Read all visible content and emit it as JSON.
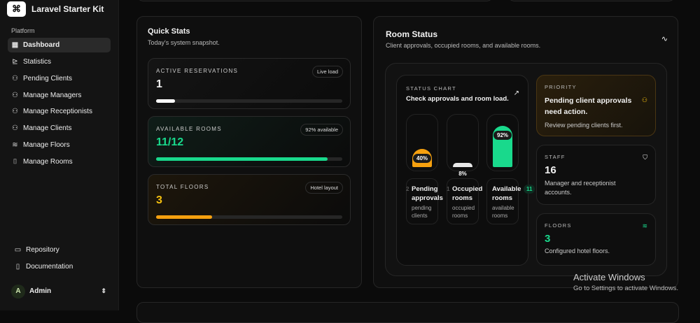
{
  "app": {
    "title": "Laravel Starter Kit",
    "logo_icon": "laravel-logo"
  },
  "sidebar": {
    "group": "Platform",
    "items": [
      {
        "label": "Dashboard",
        "icon": "grid-icon",
        "active": true
      },
      {
        "label": "Statistics",
        "icon": "chart-icon"
      },
      {
        "label": "Pending Clients",
        "icon": "users-icon"
      },
      {
        "label": "Manage Managers",
        "icon": "user-cog-icon"
      },
      {
        "label": "Manage Receptionists",
        "icon": "users-icon"
      },
      {
        "label": "Manage Clients",
        "icon": "users-icon"
      },
      {
        "label": "Manage Floors",
        "icon": "layers-icon"
      },
      {
        "label": "Manage Rooms",
        "icon": "door-icon"
      }
    ],
    "footer": [
      {
        "label": "Repository",
        "icon": "folder-git-icon"
      },
      {
        "label": "Documentation",
        "icon": "book-icon"
      }
    ],
    "user": {
      "initial": "A",
      "name": "Admin"
    }
  },
  "quick_stats": {
    "title": "Quick Stats",
    "subtitle": "Today's system snapshot.",
    "cards": [
      {
        "label": "ACTIVE RESERVATIONS",
        "value": "1",
        "badge": "Live load",
        "progress": 0.1,
        "color": "#ffffff"
      },
      {
        "label": "AVAILABLE ROOMS",
        "value": "11/12",
        "badge": "92% available",
        "progress": 0.92,
        "color": "#19d98c"
      },
      {
        "label": "TOTAL FLOORS",
        "value": "3",
        "badge": "Hotel layout",
        "progress": 0.3,
        "color": "#f5a00f"
      }
    ]
  },
  "room_status": {
    "title": "Room Status",
    "subtitle": "Client approvals, occupied rooms, and available rooms.",
    "chart": {
      "kicker": "STATUS CHART",
      "title": "Check approvals and room load.",
      "bars": [
        {
          "pct_label": "40%",
          "value": 40,
          "title": "Pending approvals",
          "sub": "pending clients",
          "count": "2",
          "color": "#f5a00f"
        },
        {
          "pct_label": "8%",
          "value": 8,
          "title": "Occupied rooms",
          "sub": "occupied rooms",
          "count": "1",
          "color": "#e8e8e8"
        },
        {
          "pct_label": "92%",
          "value": 92,
          "title": "Available rooms",
          "sub": "available rooms",
          "count": "11",
          "color": "#19d98c"
        }
      ]
    },
    "priority": {
      "kicker": "PRIORITY",
      "title": "Pending client approvals need action.",
      "desc": "Review pending clients first."
    },
    "staff": {
      "kicker": "STAFF",
      "value": "16",
      "desc": "Manager and receptionist accounts."
    },
    "floors": {
      "kicker": "FLOORS",
      "value": "3",
      "desc": "Configured hotel floors."
    }
  },
  "watermark": {
    "title": "Activate Windows",
    "sub": "Go to Settings to activate Windows."
  }
}
